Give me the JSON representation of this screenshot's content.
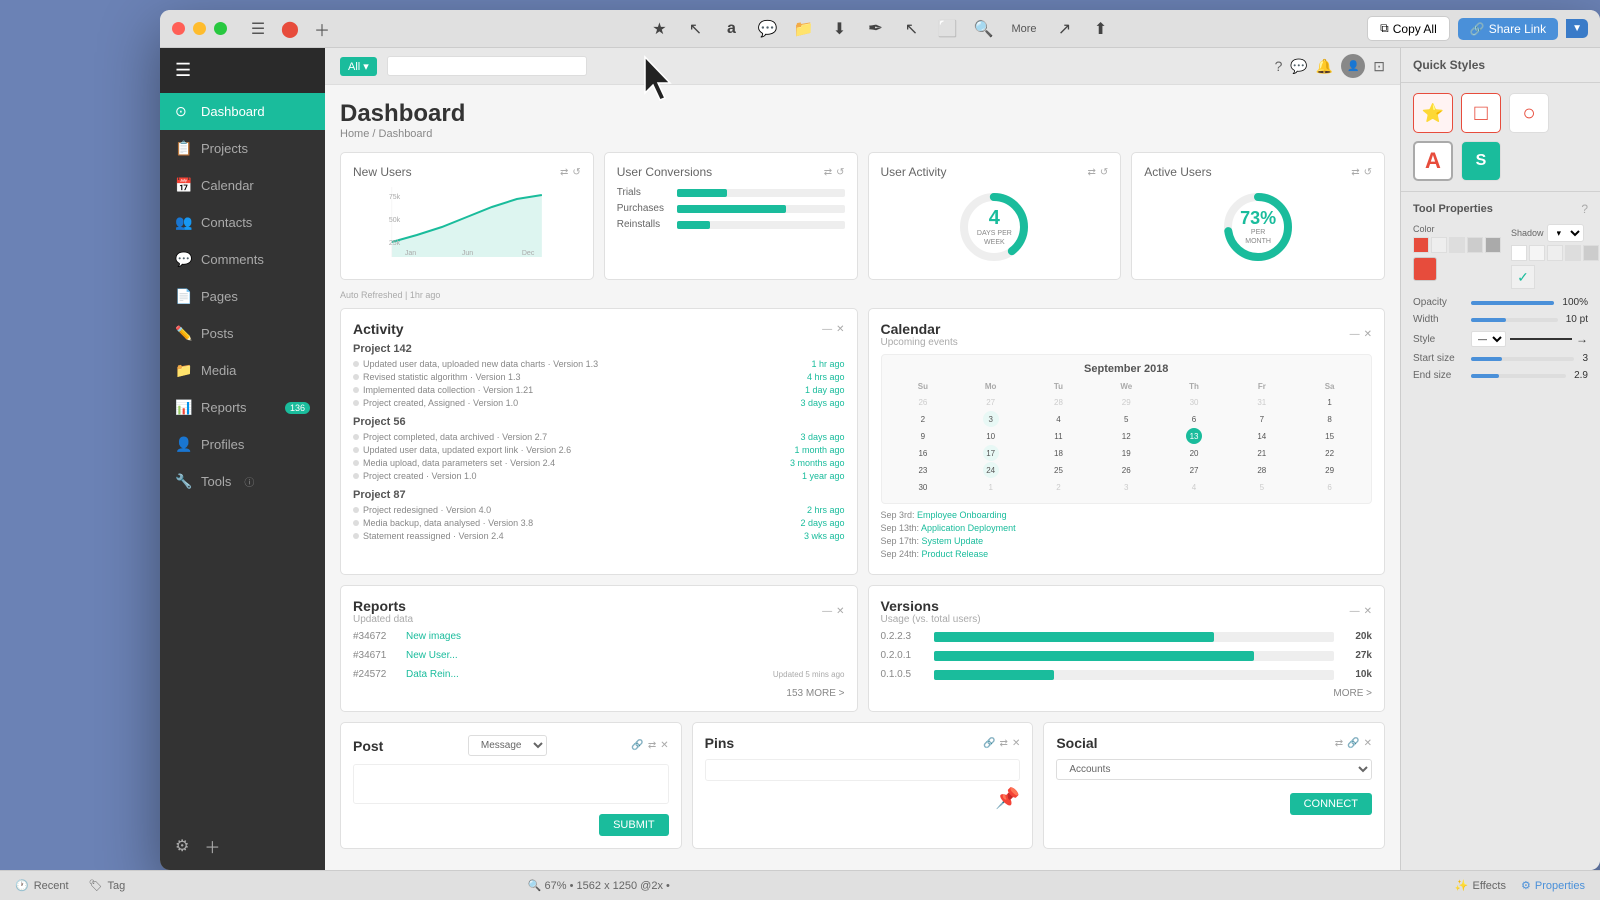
{
  "window": {
    "title": "Dashboard"
  },
  "toolbar": {
    "copy_label": "Copy All",
    "share_label": "Share Link",
    "more_label": "More"
  },
  "quick_styles": {
    "title": "Quick Styles",
    "icons": [
      {
        "name": "star-icon",
        "symbol": "⭐",
        "color": "#e74c3c"
      },
      {
        "name": "rect-icon",
        "symbol": "□",
        "color": "#e74c3c"
      },
      {
        "name": "circle-icon",
        "symbol": "○",
        "color": "#e74c3c"
      },
      {
        "name": "text-icon",
        "symbol": "A",
        "color": "#e74c3c"
      },
      {
        "name": "s-icon",
        "symbol": "S",
        "color": "#1abc9c"
      }
    ]
  },
  "tool_properties": {
    "title": "Tool Properties",
    "opacity_label": "Opacity",
    "opacity_value": "100%",
    "width_label": "Width",
    "width_value": "10 pt",
    "style_label": "Style",
    "start_size_label": "Start size",
    "start_size_value": "3",
    "end_size_label": "End size",
    "end_size_value": "2.9",
    "color_label": "Color",
    "shadow_label": "Shadow"
  },
  "sidebar": {
    "items": [
      {
        "label": "Dashboard",
        "icon": "⊙",
        "active": true
      },
      {
        "label": "Projects",
        "icon": "📋",
        "active": false
      },
      {
        "label": "Calendar",
        "icon": "📅",
        "active": false
      },
      {
        "label": "Contacts",
        "icon": "👥",
        "active": false
      },
      {
        "label": "Comments",
        "icon": "💬",
        "active": false
      },
      {
        "label": "Pages",
        "icon": "📄",
        "active": false
      },
      {
        "label": "Posts",
        "icon": "✏️",
        "active": false
      },
      {
        "label": "Media",
        "icon": "📁",
        "active": false
      },
      {
        "label": "Reports",
        "icon": "📊",
        "active": false,
        "badge": "136"
      },
      {
        "label": "Profiles",
        "icon": "🔧",
        "active": false
      },
      {
        "label": "Tools",
        "icon": "🔨",
        "active": false,
        "info": true
      }
    ]
  },
  "dashboard": {
    "title": "Dashboard",
    "breadcrumb": "Home / Dashboard",
    "auto_refresh": "Auto Refreshed | 1hr ago",
    "stat_cards": [
      {
        "title": "New Users",
        "chart_type": "line",
        "y_labels": [
          "75k",
          "50k",
          "25k"
        ],
        "x_labels": [
          "Jan",
          "Jun",
          "Dec"
        ]
      },
      {
        "title": "User Conversions",
        "items": [
          {
            "label": "Trials",
            "pct": 30
          },
          {
            "label": "Purchases",
            "pct": 65
          },
          {
            "label": "Reinstalls",
            "pct": 20
          }
        ]
      },
      {
        "title": "User Activity",
        "value": "4",
        "sub_label": "DAYS PER WEEK",
        "chart_type": "donut"
      },
      {
        "title": "Active Users",
        "value": "73%",
        "sub_label": "PER MONTH",
        "chart_type": "donut"
      }
    ],
    "activity": {
      "title": "Activity",
      "projects": [
        {
          "name": "Project 142",
          "items": [
            {
              "text": "Updated user data, uploaded new data charts",
              "version": "Version 1.3",
              "time": "1 hr ago"
            },
            {
              "text": "Revised statistic algorithm",
              "version": "Version 1.3",
              "time": "4 hrs ago"
            },
            {
              "text": "Implemented data collection",
              "version": "Version 1.21",
              "time": "1 day ago"
            },
            {
              "text": "Project created, Assigned",
              "version": "Version 1.0",
              "time": "3 days ago"
            }
          ]
        },
        {
          "name": "Project 56",
          "items": [
            {
              "text": "Project completed, data archived",
              "version": "Version 2.7",
              "time": "3 days ago"
            },
            {
              "text": "Updated user data, updated export link",
              "version": "Version 2.6",
              "time": "1 month ago"
            },
            {
              "text": "Media upload, data parameters set",
              "version": "Version 2.4",
              "time": "3 months ago"
            },
            {
              "text": "Project created",
              "version": "Version 1.0",
              "time": "1 year ago"
            }
          ]
        },
        {
          "name": "Project 87",
          "items": [
            {
              "text": "Project redesigned",
              "version": "Version 4.0",
              "time": "2 hrs ago"
            },
            {
              "text": "Media backup, data analysed",
              "version": "Version 3.8",
              "time": "2 days ago"
            },
            {
              "text": "Statement reassigned",
              "version": "Version 2.4",
              "time": "3 wks ago"
            }
          ]
        }
      ]
    },
    "calendar": {
      "title": "Calendar",
      "subtitle": "Upcoming events",
      "month": "September 2018",
      "headers": [
        "Su",
        "Mo",
        "Tu",
        "We",
        "Th",
        "Fr",
        "Sa"
      ],
      "prev_days": [
        26,
        27,
        28,
        29,
        30,
        31,
        1
      ],
      "days": [
        2,
        3,
        4,
        5,
        6,
        7,
        8,
        9,
        10,
        11,
        12,
        13,
        14,
        15,
        16,
        17,
        18,
        19,
        20,
        21,
        22,
        23,
        24,
        25,
        26,
        27,
        28,
        29,
        30
      ],
      "events": [
        {
          "date": "Sep 3rd:",
          "name": "Employee Onboarding"
        },
        {
          "date": "Sep 13th:",
          "name": "Application Deployment"
        },
        {
          "date": "Sep 17th:",
          "name": "System Update"
        },
        {
          "date": "Sep 24th:",
          "name": "Product Release"
        }
      ]
    },
    "reports": {
      "title": "Reports",
      "subtitle": "Updated data",
      "items": [
        {
          "id": "#34672",
          "name": "New images",
          "detail": ""
        },
        {
          "id": "#34671",
          "name": "New User...",
          "detail": ""
        },
        {
          "id": "#24572",
          "name": "Data Rein...",
          "detail": ""
        }
      ],
      "more_label": "153 MORE >"
    },
    "versions": {
      "title": "Versions",
      "subtitle": "Usage (vs. total users)",
      "items": [
        {
          "version": "0.2.2.3",
          "pct": 70,
          "count": "20k"
        },
        {
          "version": "0.2.0.1",
          "pct": 80,
          "count": "27k"
        },
        {
          "version": "0.1.0.5",
          "pct": 30,
          "count": "10k"
        }
      ],
      "more_label": "MORE >"
    },
    "post": {
      "title": "Post",
      "message_placeholder": "Message",
      "input_placeholder": "",
      "submit_label": "SUBMIT"
    },
    "pins": {
      "title": "Pins",
      "input_placeholder": ""
    },
    "social": {
      "title": "Social",
      "accounts_placeholder": "Accounts",
      "connect_label": "CONNECT"
    }
  },
  "status_bar": {
    "recent_label": "Recent",
    "tag_label": "Tag",
    "zoom": "67%",
    "dimensions": "1562 x 1250 @2x",
    "effects_label": "Effects",
    "properties_label": "Properties"
  }
}
